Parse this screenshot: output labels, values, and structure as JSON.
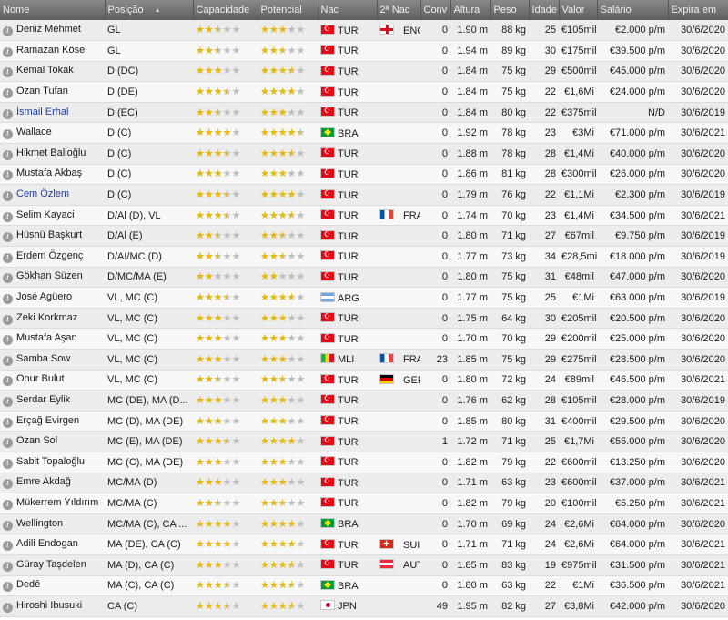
{
  "colors": {
    "header_bg": "#6f6f6f",
    "star_filled": "#e8b80a",
    "star_empty": "#bdbdbd",
    "loan_name": "#1f3ea8"
  },
  "columns": [
    "Nome",
    "Posição",
    "Capacidade",
    "Potencial",
    "Nac",
    "2ª Nac",
    "Conv",
    "Altura",
    "Peso",
    "Idade",
    "Valor",
    "Salário",
    "Expira em"
  ],
  "players": [
    {
      "name": "Deniz Mehmet",
      "pos": "GL",
      "cap": 2.5,
      "pot": 3,
      "nac": "TUR",
      "flag": "tur",
      "nac2": "ENG",
      "flag2": "eng",
      "conv": "0",
      "alt": "1.90 m",
      "peso": "88 kg",
      "idade": "25",
      "valor": "€105mil",
      "sal": "€2.000 p/m",
      "exp": "30/6/2020",
      "loan": false
    },
    {
      "name": "Ramazan Köse",
      "pos": "GL",
      "cap": 2.5,
      "pot": 2.5,
      "nac": "TUR",
      "flag": "tur",
      "nac2": "",
      "flag2": "",
      "conv": "0",
      "alt": "1.94 m",
      "peso": "89 kg",
      "idade": "30",
      "valor": "€175mil",
      "sal": "€39.500 p/m",
      "exp": "30/6/2020",
      "loan": false
    },
    {
      "name": "Kemal Tokak",
      "pos": "D (DC)",
      "cap": 3,
      "pot": 3.5,
      "nac": "TUR",
      "flag": "tur",
      "nac2": "",
      "flag2": "",
      "conv": "0",
      "alt": "1.84 m",
      "peso": "75 kg",
      "idade": "29",
      "valor": "€500mil",
      "sal": "€45.000 p/m",
      "exp": "30/6/2020",
      "loan": false
    },
    {
      "name": "Ozan Tufan",
      "pos": "D (DE)",
      "cap": 3.5,
      "pot": 4,
      "nac": "TUR",
      "flag": "tur",
      "nac2": "",
      "flag2": "",
      "conv": "0",
      "alt": "1.84 m",
      "peso": "75 kg",
      "idade": "22",
      "valor": "€1,6Mi",
      "sal": "€24.000 p/m",
      "exp": "30/6/2020",
      "loan": false
    },
    {
      "name": "İsmail Erhal",
      "pos": "D (EC)",
      "cap": 2.5,
      "pot": 3,
      "nac": "TUR",
      "flag": "tur",
      "nac2": "",
      "flag2": "",
      "conv": "0",
      "alt": "1.84 m",
      "peso": "80 kg",
      "idade": "22",
      "valor": "€375mil",
      "sal": "N/D",
      "exp": "30/6/2019",
      "loan": true
    },
    {
      "name": "Wallace",
      "pos": "D (C)",
      "cap": 4,
      "pot": 4.5,
      "nac": "BRA",
      "flag": "bra",
      "nac2": "",
      "flag2": "",
      "conv": "0",
      "alt": "1.92 m",
      "peso": "78 kg",
      "idade": "23",
      "valor": "€3Mi",
      "sal": "€71.000 p/m",
      "exp": "30/6/2021",
      "loan": false
    },
    {
      "name": "Hikmet Balioğlu",
      "pos": "D (C)",
      "cap": 3.5,
      "pot": 3.5,
      "nac": "TUR",
      "flag": "tur",
      "nac2": "",
      "flag2": "",
      "conv": "0",
      "alt": "1.88 m",
      "peso": "78 kg",
      "idade": "28",
      "valor": "€1,4Mi",
      "sal": "€40.000 p/m",
      "exp": "30/6/2020",
      "loan": false
    },
    {
      "name": "Mustafa Akbaş",
      "pos": "D (C)",
      "cap": 3,
      "pot": 3,
      "nac": "TUR",
      "flag": "tur",
      "nac2": "",
      "flag2": "",
      "conv": "0",
      "alt": "1.86 m",
      "peso": "81 kg",
      "idade": "28",
      "valor": "€300mil",
      "sal": "€26.000 p/m",
      "exp": "30/6/2020",
      "loan": false
    },
    {
      "name": "Cem Özlem",
      "pos": "D (C)",
      "cap": 3.5,
      "pot": 4,
      "nac": "TUR",
      "flag": "tur",
      "nac2": "",
      "flag2": "",
      "conv": "0",
      "alt": "1.79 m",
      "peso": "76 kg",
      "idade": "22",
      "valor": "€1,1Mi",
      "sal": "€2.300 p/m",
      "exp": "30/6/2019",
      "loan": true
    },
    {
      "name": "Selim Kayaci",
      "pos": "D/Al (D), VL",
      "cap": 3.5,
      "pot": 3.5,
      "nac": "TUR",
      "flag": "tur",
      "nac2": "FRA",
      "flag2": "fra",
      "conv": "0",
      "alt": "1.74 m",
      "peso": "70 kg",
      "idade": "23",
      "valor": "€1,4Mi",
      "sal": "€34.500 p/m",
      "exp": "30/6/2021",
      "loan": false
    },
    {
      "name": "Hüsnü Başkurt",
      "pos": "D/Al (E)",
      "cap": 2.5,
      "pot": 2.5,
      "nac": "TUR",
      "flag": "tur",
      "nac2": "",
      "flag2": "",
      "conv": "0",
      "alt": "1.80 m",
      "peso": "71 kg",
      "idade": "27",
      "valor": "€67mil",
      "sal": "€9.750 p/m",
      "exp": "30/6/2019",
      "loan": false
    },
    {
      "name": "Erdem Özgenç",
      "pos": "D/AI/MC (D)",
      "cap": 2.5,
      "pot": 2.5,
      "nac": "TUR",
      "flag": "tur",
      "nac2": "",
      "flag2": "",
      "conv": "0",
      "alt": "1.77 m",
      "peso": "73 kg",
      "idade": "34",
      "valor": "€28,5mil",
      "sal": "€18.000 p/m",
      "exp": "30/6/2019",
      "loan": false
    },
    {
      "name": "Gökhan Süzen",
      "pos": "D/MC/MA (E)",
      "cap": 2,
      "pot": 2,
      "nac": "TUR",
      "flag": "tur",
      "nac2": "",
      "flag2": "",
      "conv": "0",
      "alt": "1.80 m",
      "peso": "75 kg",
      "idade": "31",
      "valor": "€48mil",
      "sal": "€47.000 p/m",
      "exp": "30/6/2020",
      "loan": false
    },
    {
      "name": "José Agüero",
      "pos": "VL, MC (C)",
      "cap": 3.5,
      "pot": 3.5,
      "nac": "ARG",
      "flag": "arg",
      "nac2": "",
      "flag2": "",
      "conv": "0",
      "alt": "1.77 m",
      "peso": "75 kg",
      "idade": "25",
      "valor": "€1Mi",
      "sal": "€63.000 p/m",
      "exp": "30/6/2019",
      "loan": false
    },
    {
      "name": "Zeki Korkmaz",
      "pos": "VL, MC (C)",
      "cap": 3,
      "pot": 3,
      "nac": "TUR",
      "flag": "tur",
      "nac2": "",
      "flag2": "",
      "conv": "0",
      "alt": "1.75 m",
      "peso": "64 kg",
      "idade": "30",
      "valor": "€205mil",
      "sal": "€20.500 p/m",
      "exp": "30/6/2020",
      "loan": false
    },
    {
      "name": "Mustafa Aşan",
      "pos": "VL, MC (C)",
      "cap": 3,
      "pot": 3,
      "nac": "TUR",
      "flag": "tur",
      "nac2": "",
      "flag2": "",
      "conv": "0",
      "alt": "1.70 m",
      "peso": "70 kg",
      "idade": "29",
      "valor": "€200mil",
      "sal": "€25.000 p/m",
      "exp": "30/6/2020",
      "loan": false
    },
    {
      "name": "Samba Sow",
      "pos": "VL, MC (C)",
      "cap": 3,
      "pot": 3,
      "nac": "MLI",
      "flag": "mli",
      "nac2": "FRA",
      "flag2": "fra",
      "conv": "23",
      "alt": "1.85 m",
      "peso": "75 kg",
      "idade": "29",
      "valor": "€275mil",
      "sal": "€28.500 p/m",
      "exp": "30/6/2020",
      "loan": false
    },
    {
      "name": "Onur Bulut",
      "pos": "VL, MC (C)",
      "cap": 2.5,
      "pot": 2.5,
      "nac": "TUR",
      "flag": "tur",
      "nac2": "GER",
      "flag2": "ger",
      "conv": "0",
      "alt": "1.80 m",
      "peso": "72 kg",
      "idade": "24",
      "valor": "€89mil",
      "sal": "€46.500 p/m",
      "exp": "30/6/2021",
      "loan": false
    },
    {
      "name": "Serdar Eylik",
      "pos": "MC (DE), MA (D...",
      "cap": 3,
      "pot": 3,
      "nac": "TUR",
      "flag": "tur",
      "nac2": "",
      "flag2": "",
      "conv": "0",
      "alt": "1.76 m",
      "peso": "62 kg",
      "idade": "28",
      "valor": "€105mil",
      "sal": "€28.000 p/m",
      "exp": "30/6/2019",
      "loan": false
    },
    {
      "name": "Erçağ Evirgen",
      "pos": "MC (D), MA (DE)",
      "cap": 3,
      "pot": 3,
      "nac": "TUR",
      "flag": "tur",
      "nac2": "",
      "flag2": "",
      "conv": "0",
      "alt": "1.85 m",
      "peso": "80 kg",
      "idade": "31",
      "valor": "€400mil",
      "sal": "€29.500 p/m",
      "exp": "30/6/2020",
      "loan": false
    },
    {
      "name": "Ozan Sol",
      "pos": "MC (E), MA (DE)",
      "cap": 3.5,
      "pot": 4,
      "nac": "TUR",
      "flag": "tur",
      "nac2": "",
      "flag2": "",
      "conv": "1",
      "alt": "1.72 m",
      "peso": "71 kg",
      "idade": "25",
      "valor": "€1,7Mi",
      "sal": "€55.000 p/m",
      "exp": "30/6/2020",
      "loan": false
    },
    {
      "name": "Sabit Topaloğlu",
      "pos": "MC (C), MA (DE)",
      "cap": 3,
      "pot": 3,
      "nac": "TUR",
      "flag": "tur",
      "nac2": "",
      "flag2": "",
      "conv": "0",
      "alt": "1.82 m",
      "peso": "79 kg",
      "idade": "22",
      "valor": "€600mil",
      "sal": "€13.250 p/m",
      "exp": "30/6/2020",
      "loan": false
    },
    {
      "name": "Emre Akdağ",
      "pos": "MC/MA (D)",
      "cap": 3,
      "pot": 3,
      "nac": "TUR",
      "flag": "tur",
      "nac2": "",
      "flag2": "",
      "conv": "0",
      "alt": "1.71 m",
      "peso": "63 kg",
      "idade": "23",
      "valor": "€600mil",
      "sal": "€37.000 p/m",
      "exp": "30/6/2021",
      "loan": false
    },
    {
      "name": "Mükerrem Yıldırım",
      "pos": "MC/MA (C)",
      "cap": 2.5,
      "pot": 2.5,
      "nac": "TUR",
      "flag": "tur",
      "nac2": "",
      "flag2": "",
      "conv": "0",
      "alt": "1.82 m",
      "peso": "79 kg",
      "idade": "20",
      "valor": "€100mil",
      "sal": "€5.250 p/m",
      "exp": "30/6/2021",
      "loan": false
    },
    {
      "name": "Wellington",
      "pos": "MC/MA (C), CA ...",
      "cap": 4,
      "pot": 4,
      "nac": "BRA",
      "flag": "bra",
      "nac2": "",
      "flag2": "",
      "conv": "0",
      "alt": "1.70 m",
      "peso": "69 kg",
      "idade": "24",
      "valor": "€2,6Mi",
      "sal": "€64.000 p/m",
      "exp": "30/6/2020",
      "loan": false
    },
    {
      "name": "Adili Endogan",
      "pos": "MA (DE), CA (C)",
      "cap": 4,
      "pot": 4,
      "nac": "TUR",
      "flag": "tur",
      "nac2": "SUI",
      "flag2": "sui",
      "conv": "0",
      "alt": "1.71 m",
      "peso": "71 kg",
      "idade": "24",
      "valor": "€2,6Mi",
      "sal": "€64.000 p/m",
      "exp": "30/6/2021",
      "loan": false
    },
    {
      "name": "Güray Taşdelen",
      "pos": "MA (D), CA (C)",
      "cap": 3,
      "pot": 3.5,
      "nac": "TUR",
      "flag": "tur",
      "nac2": "AUT",
      "flag2": "aut",
      "conv": "0",
      "alt": "1.85 m",
      "peso": "83 kg",
      "idade": "19",
      "valor": "€975mil",
      "sal": "€31.500 p/m",
      "exp": "30/6/2021",
      "loan": false
    },
    {
      "name": "Dedê",
      "pos": "MA (C), CA (C)",
      "cap": 3.5,
      "pot": 3.5,
      "nac": "BRA",
      "flag": "bra",
      "nac2": "",
      "flag2": "",
      "conv": "0",
      "alt": "1.80 m",
      "peso": "63 kg",
      "idade": "22",
      "valor": "€1Mi",
      "sal": "€36.500 p/m",
      "exp": "30/6/2021",
      "loan": false
    },
    {
      "name": "Hiroshi Ibusuki",
      "pos": "CA (C)",
      "cap": 3.5,
      "pot": 3.5,
      "nac": "JPN",
      "flag": "jpn",
      "nac2": "",
      "flag2": "",
      "conv": "49",
      "alt": "1.95 m",
      "peso": "82 kg",
      "idade": "27",
      "valor": "€3,8Mi",
      "sal": "€42.000 p/m",
      "exp": "30/6/2020",
      "loan": false
    }
  ]
}
